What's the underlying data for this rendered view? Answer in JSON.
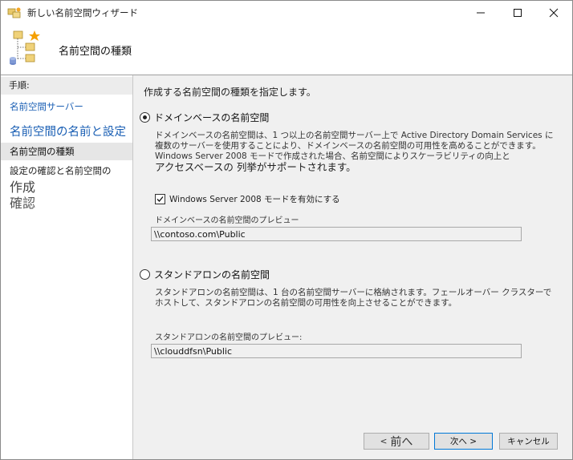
{
  "window": {
    "title": "新しい名前空間ウィザード",
    "controls": [
      "minimize",
      "maximize",
      "close"
    ]
  },
  "header": {
    "title": "名前空間の種類"
  },
  "steps": {
    "heading": "手順:",
    "items": [
      {
        "label": "名前空間サーバー",
        "state": "link"
      },
      {
        "label": "名前空間の名前と設定",
        "state": "link"
      },
      {
        "label": "名前空間の種類",
        "state": "current"
      },
      {
        "label_line1": "設定の確認と名前空間の",
        "label_line2": "作成",
        "state": "pending"
      },
      {
        "label": "確認",
        "state": "pending"
      }
    ]
  },
  "main": {
    "instruction": "作成する名前空間の種類を指定します。",
    "domain_option": {
      "label": "ドメインベースの名前空間",
      "selected": true,
      "desc_line1": "ドメインベースの名前空間は、1 つ以上の名前空間サーバー上で Active Directory Domain Services に",
      "desc_line2": "複数のサーバーを使用することにより、ドメインベースの名前空間の可用性を高めることができます。",
      "desc_line3": "Windows Server 2008 モードで作成された場合、名前空間によりスケーラビリティの向上と",
      "desc_line4": "アクセスベースの 列挙がサポートされます。",
      "checkbox_label": "Windows Server 2008 モードを有効にする",
      "checkbox_checked": true,
      "preview_label": "ドメインベースの名前空間のプレビュー",
      "preview_value": "\\\\contoso.com\\Public"
    },
    "standalone_option": {
      "label": "スタンドアロンの名前空間",
      "selected": false,
      "desc_line1": "スタンドアロンの名前空間は、1 台の名前空間サーバーに格納されます。フェールオーバー クラスターで",
      "desc_line2": "ホストして、スタンドアロンの名前空間の可用性を向上させることができます。",
      "preview_label": "スタンドアロンの名前空間のプレビュー:",
      "preview_value": "\\\\clouddfsn\\Public"
    }
  },
  "buttons": {
    "back_prefix": "<",
    "back_label": "前へ",
    "next_label": "次へ >",
    "cancel_label": "キャンセル"
  }
}
